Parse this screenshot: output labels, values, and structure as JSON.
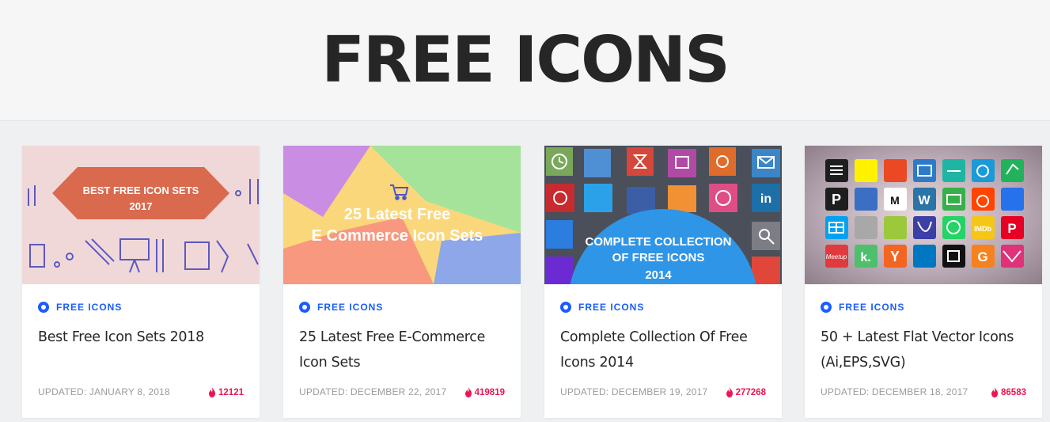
{
  "page": {
    "title": "FREE ICONS"
  },
  "cards": [
    {
      "category": "FREE ICONS",
      "title": "Best Free Icon Sets 2018",
      "updated": "UPDATED: JANUARY 8, 2018",
      "views": "12121",
      "thumb": {
        "line1": "BEST FREE ICON SETS",
        "line2": "2017"
      }
    },
    {
      "category": "FREE ICONS",
      "title": "25 Latest Free E-Commerce Icon Sets",
      "updated": "UPDATED: DECEMBER 22, 2017",
      "views": "419819",
      "thumb": {
        "line1": "25 Latest Free",
        "line2": "E Commerce Icon Sets"
      }
    },
    {
      "category": "FREE ICONS",
      "title": "Complete Collection Of Free Icons 2014",
      "updated": "UPDATED: DECEMBER 19, 2017",
      "views": "277268",
      "thumb": {
        "line1": "COMPLETE COLLECTION",
        "line2": "OF FREE ICONS",
        "line3": "2014"
      }
    },
    {
      "category": "FREE ICONS",
      "title": "50 + Latest Flat Vector Icons (Ai,EPS,SVG)",
      "updated": "UPDATED: DECEMBER 18, 2017",
      "views": "86583",
      "thumb": {
        "meetup": "Meetup"
      }
    }
  ],
  "colors": {
    "accent": "#1a5cff",
    "views": "#ec1551",
    "heading": "#262626"
  }
}
